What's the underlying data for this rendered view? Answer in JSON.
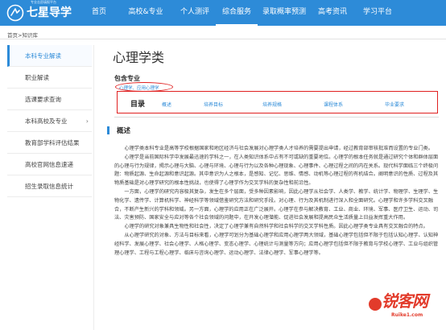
{
  "brand": {
    "name": "七星导学",
    "slogan": "专业志愿填报平台"
  },
  "nav": {
    "items": [
      {
        "label": "首页",
        "active": false
      },
      {
        "label": "高校&专业",
        "active": false
      },
      {
        "label": "个人测评",
        "active": false
      },
      {
        "label": "综合服务",
        "active": true
      },
      {
        "label": "录取概率预测",
        "active": false
      },
      {
        "label": "高考资讯",
        "active": false
      },
      {
        "label": "学习平台",
        "active": false
      }
    ]
  },
  "breadcrumb": "首页>知识库",
  "sidebar": {
    "items": [
      {
        "label": "本科专业解读",
        "active": true,
        "expandable": false
      },
      {
        "label": "职业解读",
        "active": false,
        "expandable": false
      },
      {
        "label": "选课要求查询",
        "active": false,
        "expandable": false
      },
      {
        "label": "本科高校及专业",
        "active": false,
        "expandable": true
      },
      {
        "label": "教育部学科评估结果",
        "active": false,
        "expandable": false
      },
      {
        "label": "高校官网信息速递",
        "active": false,
        "expandable": false
      },
      {
        "label": "招生录取信息统计",
        "active": false,
        "expandable": false
      }
    ]
  },
  "content": {
    "title": "心理学类",
    "section_label": "包含专业",
    "tag_link": "心理学、应用心理学",
    "toc": {
      "title": "目录",
      "links": [
        "概述",
        "培养目标",
        "培养规格",
        "课程体系",
        "毕业要求"
      ]
    },
    "overview_label": "概述",
    "paragraphs": [
      "心理学类本科专业是高等学校根据国家和地区经济与社会发展对心理学类人才培养的需要提出申请，经过教育部审核批准而设置的专业门类。",
      "心理学是当前国际科学中发展最迅速的学科之一，在人类知识体系中占有不可或缺的重要地位。心理学的根本任务就是通过研究个体和群体层面的心理与行为规律，揭示心理与大脑、心理与环境、心理与行为以及各种心理现象、心理事件、心理过程之间的内在关系。现代科学面临三个终极问题：物质起源、生命起源和意识起源。其中意识为人之根本，是感知、记忆、思维、情感、动机等心理过程的有机结合。阐明意识的性质、过程及其物质基础是对心理学研究的根本性挑战，也使得了心理学作为交叉学科的复杂性和前沿性。",
      "一方面，心理学的研究内容极其复杂，发生在多个层面，受多种因素影响，因此心理学从社会学、人类学、教学、统计学、物理学、生理学、生物化学、遗传学、计算机科学、神经科学等领域借鉴研究方法和研究手段。对心理、行为及其机制进行深入和全面研究。心理学和许多学科交叉融合，不断产生新兴的学科和领域。另一方面，心理学的应用正在广泛展开。心理学在参与解决教育、工业、商业、环境、军事、医疗卫生、运动、司法、灾害预防、国家安全与应对等各个社会领域的问题中，在开发心理潜能、促进社会发展和提高民众生活质量上日益发挥重大作用。",
      "心理学的研究对象兼具生物性和社会性，决定了心理学兼有自然科学和社会科学的交叉学科性质。因此心理学类专业具有交叉融合的特点。",
      "从心理学研究的对象、方法与目标来看，心理学可划分为基础心理学和应用心理学两大领域，基础心理学包括但不限于包括认知心理学、认知神经科学、发展心理学、社会心理学、人格心理学、变态心理学、心理统计与测量等方向；应用心理学包括但不限于教育与学校心理学、工业与组织管理心理学、工程与工程心理学、临床与咨询心理学、运动心理学、法律心理学、军事心理学等。"
    ]
  },
  "watermark": {
    "text": "锐客网",
    "url": "Ruike1.com"
  },
  "colors": {
    "primary": "#2d8bd8",
    "highlight_red": "#e02020"
  }
}
